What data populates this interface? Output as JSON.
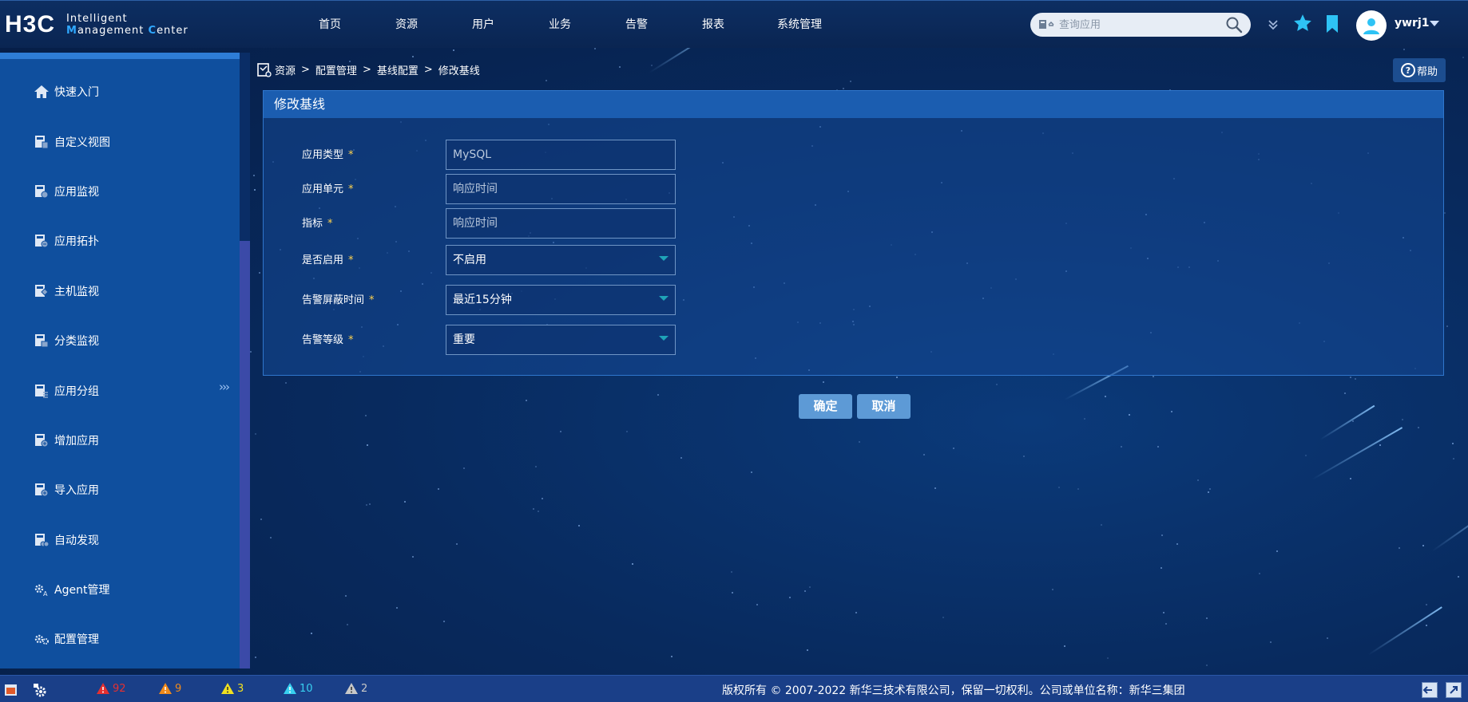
{
  "app": {
    "logo_mark": "H3C",
    "logo_line1": "Intelligent",
    "logo_line2a": "M",
    "logo_line2b": "anagement ",
    "logo_line2c": "C",
    "logo_line2d": "enter"
  },
  "nav": [
    "首页",
    "资源",
    "用户",
    "业务",
    "告警",
    "报表",
    "系统管理"
  ],
  "search": {
    "placeholder": "查询应用"
  },
  "user": {
    "name": "ywrj1"
  },
  "sidebar": {
    "items": [
      {
        "label": "快速入门",
        "icon": "home-icon"
      },
      {
        "label": "自定义视图",
        "icon": "custom-view-icon"
      },
      {
        "label": "应用监视",
        "icon": "app-monitor-icon"
      },
      {
        "label": "应用拓扑",
        "icon": "app-topology-icon"
      },
      {
        "label": "主机监视",
        "icon": "host-monitor-icon"
      },
      {
        "label": "分类监视",
        "icon": "category-monitor-icon"
      },
      {
        "label": "应用分组",
        "icon": "app-group-icon"
      },
      {
        "label": "增加应用",
        "icon": "add-app-icon"
      },
      {
        "label": "导入应用",
        "icon": "import-app-icon"
      },
      {
        "label": "自动发现",
        "icon": "auto-discover-icon"
      },
      {
        "label": "Agent管理",
        "icon": "agent-manage-icon"
      },
      {
        "label": "配置管理",
        "icon": "config-manage-icon"
      }
    ],
    "collapse_glyph": "›››"
  },
  "breadcrumb": [
    "资源",
    "配置管理",
    "基线配置",
    "修改基线"
  ],
  "help": {
    "label": "帮助"
  },
  "panel": {
    "title": "修改基线",
    "fields": [
      {
        "label": "应用类型",
        "value": "MySQL",
        "type": "readonly"
      },
      {
        "label": "应用单元",
        "value": "响应时间",
        "type": "readonly"
      },
      {
        "label": "指标",
        "value": "响应时间",
        "type": "readonly"
      },
      {
        "label": "是否启用",
        "value": "不启用",
        "type": "select"
      },
      {
        "label": "告警屏蔽时间",
        "value": "最近15分钟",
        "type": "select"
      },
      {
        "label": "告警等级",
        "value": "重要",
        "type": "select"
      }
    ],
    "required_mark": "*"
  },
  "actions": {
    "confirm": "确定",
    "cancel": "取消"
  },
  "status": {
    "alarms": [
      {
        "count": "92",
        "color": "#e53030"
      },
      {
        "count": "9",
        "color": "#f08a1a"
      },
      {
        "count": "3",
        "color": "#f0e020"
      },
      {
        "count": "10",
        "color": "#38d0f0"
      },
      {
        "count": "2",
        "color": "#c8c8c8"
      }
    ],
    "copyright": "版权所有 © 2007-2022 新华三技术有限公司，保留一切权利。公司或单位名称：新华三集团"
  }
}
